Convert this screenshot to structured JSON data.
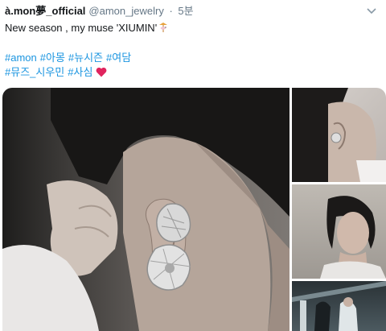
{
  "tweet": {
    "display_name": "à.mon夢_official",
    "handle": "@amon_jewelry",
    "separator": "·",
    "time": "5분",
    "text": "New season , my muse 'XIUMIN'",
    "hashtags_line1": [
      "#amon",
      "#아몽",
      "#뉴시즌",
      "#여담"
    ],
    "hashtags_line2": [
      "#뮤즈_시우민",
      "#사심"
    ]
  },
  "icons": {
    "caret": "chevron-down-icon",
    "carousel_emoji": "carousel-horse-emoji",
    "heart": "red-heart-emoji"
  },
  "colors": {
    "link": "#1b95e0",
    "secondary_text": "#657786",
    "heart": "#e0245e"
  }
}
